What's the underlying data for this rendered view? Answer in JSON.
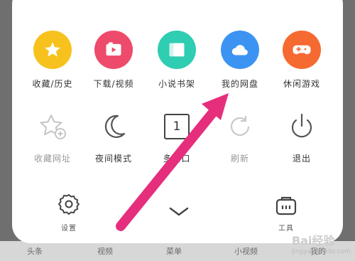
{
  "bottom_nav": [
    "头条",
    "视频",
    "菜单",
    "小视频",
    "我的"
  ],
  "row1": [
    {
      "label": "收藏/历史",
      "icon": "star-icon",
      "color": "#f7c21e"
    },
    {
      "label": "下载/视频",
      "icon": "download-video-icon",
      "color": "#ee4a6b"
    },
    {
      "label": "小说书架",
      "icon": "book-icon",
      "color": "#2fcdb1"
    },
    {
      "label": "我的网盘",
      "icon": "cloud-icon",
      "color": "#3d93f2"
    },
    {
      "label": "休闲游戏",
      "icon": "gamepad-icon",
      "color": "#f66a31"
    }
  ],
  "row2": [
    {
      "label": "收藏网址",
      "icon": "add-bookmark-icon"
    },
    {
      "label": "夜间模式",
      "icon": "moon-icon"
    },
    {
      "label": "多窗口",
      "icon": "window-count-icon",
      "count": "1"
    },
    {
      "label": "刷新",
      "icon": "refresh-icon"
    },
    {
      "label": "退出",
      "icon": "power-icon"
    }
  ],
  "bottom": {
    "settings": "设置",
    "tools": "工具"
  },
  "watermark": {
    "brand": "Bai经验",
    "url": "jingyan.baidu.com"
  },
  "colors": {
    "arrow": "#e52f7c"
  }
}
